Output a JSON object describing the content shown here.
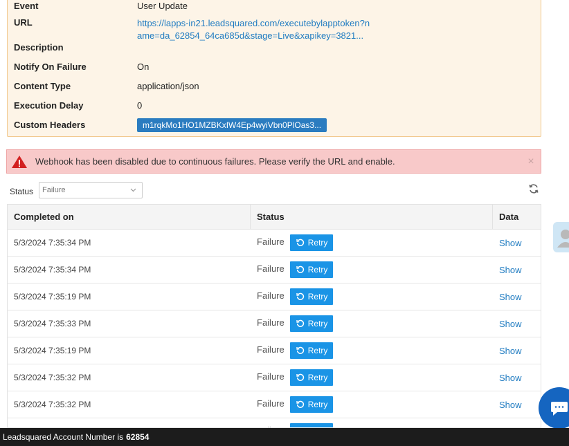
{
  "details": {
    "event_label": "Event",
    "event_value": "User Update",
    "url_label": "URL",
    "url_value": "https://lapps-in21.leadsquared.com/executebylapptoken?name=da_62854_64ca685d&stage=Live&xapikey=3821...",
    "description_label": "Description",
    "notify_label": "Notify On Failure",
    "notify_value": "On",
    "content_type_label": "Content Type",
    "content_type_value": "application/json",
    "delay_label": "Execution Delay",
    "delay_value": "0",
    "headers_label": "Custom Headers",
    "headers_value": "m1rqkMo1HO1MZBKxIW4Ep4wyiVbn0PlOas3..."
  },
  "alert": {
    "message": "Webhook has been disabled due to continuous failures. Please verify the URL and enable.",
    "close": "×",
    "icon": "warning-icon",
    "color": "#f8c9c9"
  },
  "filter": {
    "label": "Status",
    "value": "Failure"
  },
  "table": {
    "headers": {
      "completed": "Completed on",
      "status": "Status",
      "data": "Data"
    },
    "retry_label": "Retry",
    "show_label": "Show",
    "rows": [
      {
        "completed": "5/3/2024 7:35:34 PM",
        "status": "Failure"
      },
      {
        "completed": "5/3/2024 7:35:34 PM",
        "status": "Failure"
      },
      {
        "completed": "5/3/2024 7:35:19 PM",
        "status": "Failure"
      },
      {
        "completed": "5/3/2024 7:35:33 PM",
        "status": "Failure"
      },
      {
        "completed": "5/3/2024 7:35:19 PM",
        "status": "Failure"
      },
      {
        "completed": "5/3/2024 7:35:32 PM",
        "status": "Failure"
      },
      {
        "completed": "5/3/2024 7:35:32 PM",
        "status": "Failure"
      },
      {
        "completed": "",
        "status": "Failure"
      }
    ]
  },
  "footer": {
    "text": "Leadsquared Account Number is",
    "account": "62854"
  },
  "colors": {
    "accent": "#1a94e6",
    "link": "#1f7bc1",
    "footer": "#1c1c1c"
  }
}
